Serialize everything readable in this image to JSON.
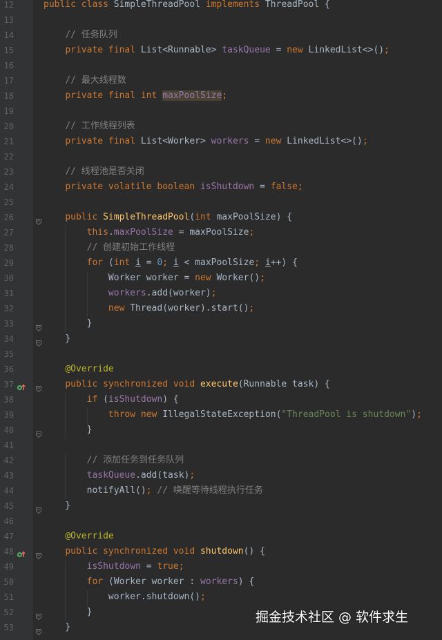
{
  "editor": {
    "lines": [
      {
        "num": "12",
        "tokens": [
          [
            "k",
            "public class "
          ],
          [
            "p",
            "SimpleThreadPool "
          ],
          [
            "k",
            "implements "
          ],
          [
            "p",
            "ThreadPool {"
          ]
        ]
      },
      {
        "num": "13",
        "tokens": []
      },
      {
        "num": "14",
        "tokens": [
          [
            "p",
            "    "
          ],
          [
            "c",
            "// 任务队列"
          ]
        ]
      },
      {
        "num": "15",
        "tokens": [
          [
            "p",
            "    "
          ],
          [
            "k",
            "private final "
          ],
          [
            "p",
            "List<Runnable> "
          ],
          [
            "f",
            "taskQueue"
          ],
          [
            "p",
            " = "
          ],
          [
            "k",
            "new "
          ],
          [
            "p",
            "LinkedList<>()"
          ],
          [
            "k",
            ";"
          ]
        ]
      },
      {
        "num": "16",
        "tokens": []
      },
      {
        "num": "17",
        "tokens": [
          [
            "p",
            "    "
          ],
          [
            "c",
            "// 最大线程数"
          ]
        ]
      },
      {
        "num": "18",
        "tokens": [
          [
            "p",
            "    "
          ],
          [
            "k",
            "private final int "
          ],
          [
            "fh",
            "maxPoolSize"
          ],
          [
            "k",
            ";"
          ]
        ]
      },
      {
        "num": "19",
        "tokens": []
      },
      {
        "num": "20",
        "tokens": [
          [
            "p",
            "    "
          ],
          [
            "c",
            "// 工作线程列表"
          ]
        ]
      },
      {
        "num": "21",
        "tokens": [
          [
            "p",
            "    "
          ],
          [
            "k",
            "private final "
          ],
          [
            "p",
            "List<Worker> "
          ],
          [
            "f",
            "workers"
          ],
          [
            "p",
            " = "
          ],
          [
            "k",
            "new "
          ],
          [
            "p",
            "LinkedList<>()"
          ],
          [
            "k",
            ";"
          ]
        ]
      },
      {
        "num": "22",
        "tokens": []
      },
      {
        "num": "23",
        "tokens": [
          [
            "p",
            "    "
          ],
          [
            "c",
            "// 线程池是否关闭"
          ]
        ]
      },
      {
        "num": "24",
        "tokens": [
          [
            "p",
            "    "
          ],
          [
            "k",
            "private volatile boolean "
          ],
          [
            "f",
            "isShutdown"
          ],
          [
            "p",
            " = "
          ],
          [
            "k",
            "false;"
          ]
        ]
      },
      {
        "num": "25",
        "tokens": []
      },
      {
        "num": "26",
        "tokens": [
          [
            "p",
            "    "
          ],
          [
            "k",
            "public "
          ],
          [
            "m",
            "SimpleThreadPool"
          ],
          [
            "p",
            "("
          ],
          [
            "k",
            "int "
          ],
          [
            "p",
            "maxPoolSize) {"
          ]
        ]
      },
      {
        "num": "27",
        "tokens": [
          [
            "p",
            "        "
          ],
          [
            "k",
            "this"
          ],
          [
            "p",
            "."
          ],
          [
            "f",
            "maxPoolSize"
          ],
          [
            "p",
            " = maxPoolSize"
          ],
          [
            "k",
            ";"
          ]
        ]
      },
      {
        "num": "28",
        "tokens": [
          [
            "p",
            "        "
          ],
          [
            "c",
            "// 创建初始工作线程"
          ]
        ]
      },
      {
        "num": "29",
        "tokens": [
          [
            "p",
            "        "
          ],
          [
            "k",
            "for "
          ],
          [
            "p",
            "("
          ],
          [
            "k",
            "int "
          ],
          [
            "u",
            "i"
          ],
          [
            "p",
            " = "
          ],
          [
            "n",
            "0"
          ],
          [
            "k",
            "; "
          ],
          [
            "u",
            "i"
          ],
          [
            "p",
            " < maxPoolSize"
          ],
          [
            "k",
            "; "
          ],
          [
            "u",
            "i"
          ],
          [
            "p",
            "++) {"
          ]
        ]
      },
      {
        "num": "30",
        "tokens": [
          [
            "p",
            "            Worker worker = "
          ],
          [
            "k",
            "new "
          ],
          [
            "p",
            "Worker()"
          ],
          [
            "k",
            ";"
          ]
        ]
      },
      {
        "num": "31",
        "tokens": [
          [
            "p",
            "            "
          ],
          [
            "f",
            "workers"
          ],
          [
            "p",
            ".add(worker)"
          ],
          [
            "k",
            ";"
          ]
        ]
      },
      {
        "num": "32",
        "tokens": [
          [
            "p",
            "            "
          ],
          [
            "k",
            "new "
          ],
          [
            "p",
            "Thread(worker).start()"
          ],
          [
            "k",
            ";"
          ]
        ]
      },
      {
        "num": "33",
        "tokens": [
          [
            "p",
            "        }"
          ]
        ]
      },
      {
        "num": "34",
        "tokens": [
          [
            "p",
            "    }"
          ]
        ]
      },
      {
        "num": "35",
        "tokens": []
      },
      {
        "num": "36",
        "tokens": [
          [
            "p",
            "    "
          ],
          [
            "a",
            "@Override"
          ]
        ]
      },
      {
        "num": "37",
        "tokens": [
          [
            "p",
            "    "
          ],
          [
            "k",
            "public synchronized void "
          ],
          [
            "m",
            "execute"
          ],
          [
            "p",
            "(Runnable task) {"
          ]
        ]
      },
      {
        "num": "38",
        "tokens": [
          [
            "p",
            "        "
          ],
          [
            "k",
            "if "
          ],
          [
            "p",
            "("
          ],
          [
            "f",
            "isShutdown"
          ],
          [
            "p",
            ") {"
          ]
        ]
      },
      {
        "num": "39",
        "tokens": [
          [
            "p",
            "            "
          ],
          [
            "k",
            "throw new "
          ],
          [
            "p",
            "IllegalStateException("
          ],
          [
            "s",
            "\"ThreadPool is shutdown\""
          ],
          [
            "p",
            ")"
          ],
          [
            "k",
            ";"
          ]
        ]
      },
      {
        "num": "40",
        "tokens": [
          [
            "p",
            "        }"
          ]
        ]
      },
      {
        "num": "41",
        "tokens": []
      },
      {
        "num": "42",
        "tokens": [
          [
            "p",
            "        "
          ],
          [
            "c",
            "// 添加任务到任务队列"
          ]
        ]
      },
      {
        "num": "43",
        "tokens": [
          [
            "p",
            "        "
          ],
          [
            "f",
            "taskQueue"
          ],
          [
            "p",
            ".add(task)"
          ],
          [
            "k",
            ";"
          ]
        ]
      },
      {
        "num": "44",
        "tokens": [
          [
            "p",
            "        notifyAll()"
          ],
          [
            "k",
            "; "
          ],
          [
            "c",
            "// 唤醒等待线程执行任务"
          ]
        ]
      },
      {
        "num": "45",
        "tokens": [
          [
            "p",
            "    }"
          ]
        ]
      },
      {
        "num": "46",
        "tokens": []
      },
      {
        "num": "47",
        "tokens": [
          [
            "p",
            "    "
          ],
          [
            "a",
            "@Override"
          ]
        ]
      },
      {
        "num": "48",
        "tokens": [
          [
            "p",
            "    "
          ],
          [
            "k",
            "public synchronized void "
          ],
          [
            "m",
            "shutdown"
          ],
          [
            "p",
            "() {"
          ]
        ]
      },
      {
        "num": "49",
        "tokens": [
          [
            "p",
            "        "
          ],
          [
            "f",
            "isShutdown"
          ],
          [
            "p",
            " = "
          ],
          [
            "k",
            "true;"
          ]
        ]
      },
      {
        "num": "50",
        "tokens": [
          [
            "p",
            "        "
          ],
          [
            "k",
            "for "
          ],
          [
            "p",
            "(Worker worker : "
          ],
          [
            "f",
            "workers"
          ],
          [
            "p",
            ") {"
          ]
        ]
      },
      {
        "num": "51",
        "tokens": [
          [
            "p",
            "            worker.shutdown()"
          ],
          [
            "k",
            ";"
          ]
        ]
      },
      {
        "num": "52",
        "tokens": [
          [
            "p",
            "        }"
          ]
        ]
      },
      {
        "num": "53",
        "tokens": [
          [
            "p",
            "    }"
          ]
        ]
      }
    ],
    "fold_markers": [
      "26",
      "33",
      "34",
      "37",
      "40",
      "45",
      "48",
      "52",
      "53"
    ],
    "gutter_icons": [
      {
        "line": "37",
        "icon": "override-method-icon"
      },
      {
        "line": "48",
        "icon": "override-method-icon"
      }
    ]
  },
  "watermark": "掘金技术社区 @ 软件求生",
  "colors": {
    "background": "#2b2b2b",
    "keyword": "#cc7832",
    "comment": "#808080",
    "field": "#9876aa",
    "method": "#ffc66d",
    "string": "#6a8759",
    "annotation": "#bbb529",
    "number": "#6897bb",
    "text": "#a9b7c6"
  }
}
